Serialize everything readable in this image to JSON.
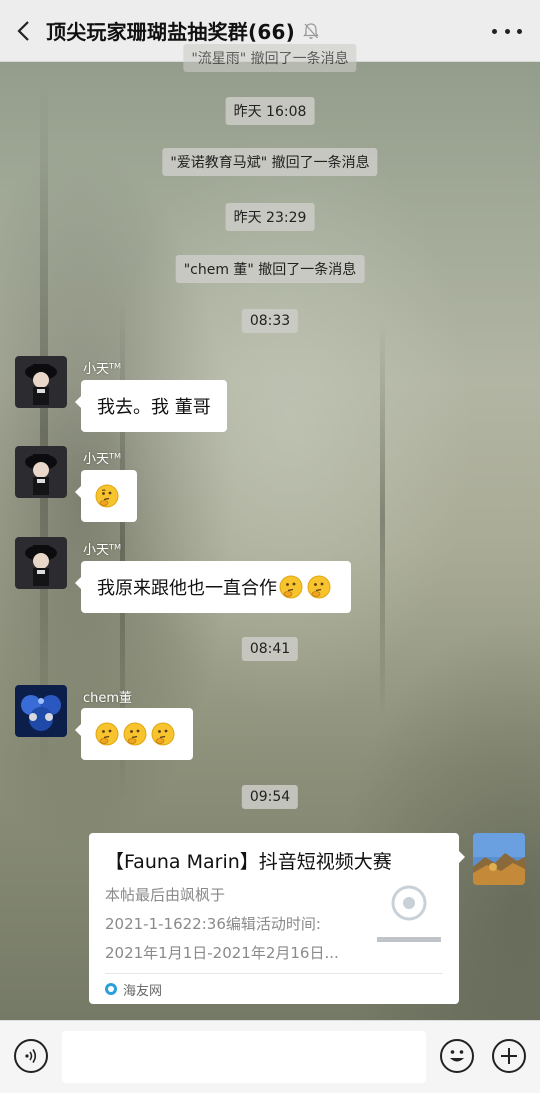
{
  "header": {
    "title": "顶尖玩家珊瑚盐抽奖群(66)"
  },
  "messages": {
    "partial_top": "\"流星雨\" 撤回了一条消息",
    "time1": "昨天 16:08",
    "recall1": "\"爱诺教育马斌\" 撤回了一条消息",
    "time2": "昨天 23:29",
    "recall2": "\"chem 董\" 撤回了一条消息",
    "time3": "08:33",
    "msg1": {
      "sender": "小天ᵀᴹ",
      "text": "我去。我 董哥"
    },
    "msg2": {
      "sender": "小天ᵀᴹ",
      "emoji_count": 1
    },
    "msg3": {
      "sender": "小天ᵀᴹ",
      "text": "我原来跟他也一直合作"
    },
    "time4": "08:41",
    "msg4": {
      "sender": "chem董",
      "emoji_count": 3
    },
    "time5": "09:54"
  },
  "card": {
    "title": "【Fauna Marin】抖音短视频大赛",
    "desc_line1": "本帖最后由飒枫于",
    "desc_line2": "2021-1-1622:36编辑活动时间:",
    "desc_line3": "2021年1月1日-2021年2月16日...",
    "source": "海友网"
  },
  "input": {
    "placeholder": ""
  },
  "colors": {
    "header_bg": "#ededed",
    "bubble_bg": "#ffffff",
    "link_source": "#2ba0d8"
  }
}
